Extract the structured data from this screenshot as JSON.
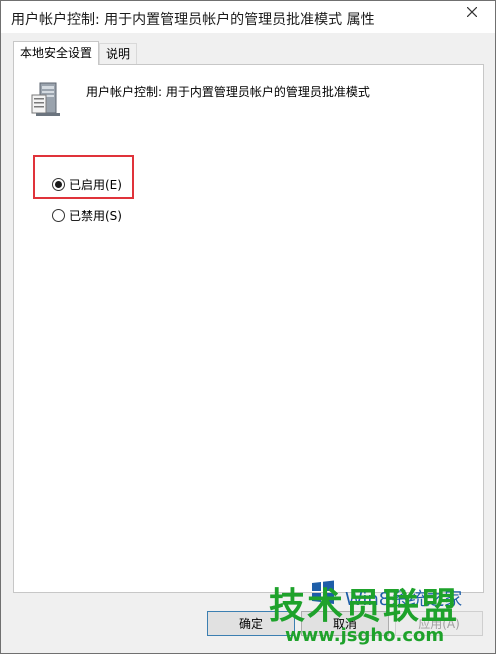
{
  "window": {
    "title": "用户帐户控制: 用于内置管理员帐户的管理员批准模式 属性"
  },
  "tabs": [
    {
      "label": "本地安全设置",
      "active": true
    },
    {
      "label": "说明",
      "active": false
    }
  ],
  "policy": {
    "name": "用户帐户控制: 用于内置管理员帐户的管理员批准模式",
    "icon": "server-policy-icon"
  },
  "options": {
    "enabled_label": "已启用(E)",
    "disabled_label": "已禁用(S)",
    "selected": "enabled"
  },
  "buttons": {
    "ok": "确定",
    "cancel": "取消",
    "apply": "应用(A)"
  },
  "watermark": {
    "top_text": "Win8系统之家",
    "brand": "技术员联盟",
    "url": "www.jsgho.com"
  },
  "colors": {
    "highlight_border": "#e0333a",
    "watermark_green": "#1ea22b",
    "watermark_blue": "#1e5ea8"
  }
}
